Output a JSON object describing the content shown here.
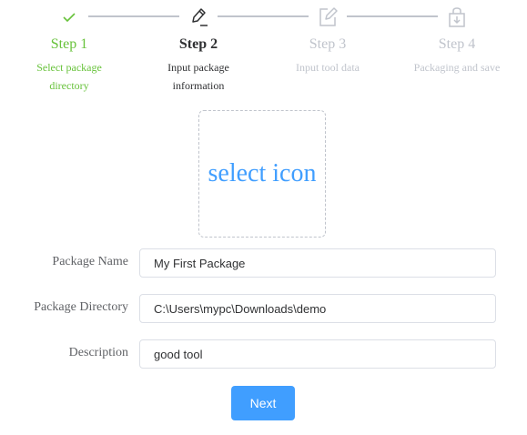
{
  "steps": [
    {
      "title": "Step 1",
      "desc": "Select package directory",
      "status": "done",
      "icon": "check-icon"
    },
    {
      "title": "Step 2",
      "desc": "Input package information",
      "status": "active",
      "icon": "pencil-icon"
    },
    {
      "title": "Step 3",
      "desc": "Input tool data",
      "status": "wait",
      "icon": "edit-icon"
    },
    {
      "title": "Step 4",
      "desc": "Packaging and save",
      "status": "wait",
      "icon": "shopping-bag-icon"
    }
  ],
  "colors": {
    "done": "#67c23a",
    "active": "#303133",
    "wait": "#c0c4cc",
    "primary": "#409eff"
  },
  "icon_picker": {
    "label": "select icon"
  },
  "form": {
    "package_name": {
      "label": "Package Name",
      "value": "My First Package"
    },
    "package_directory": {
      "label": "Package Directory",
      "value": "C:\\Users\\mypc\\Downloads\\demo"
    },
    "description": {
      "label": "Description",
      "value": "good tool"
    }
  },
  "actions": {
    "next_label": "Next"
  }
}
